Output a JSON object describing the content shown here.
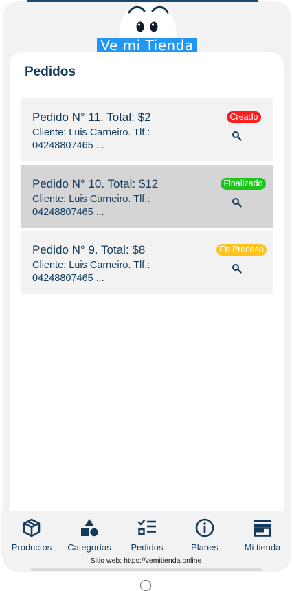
{
  "brand": {
    "name": "Ve mi Tienda"
  },
  "page": {
    "title": "Pedidos"
  },
  "orders": [
    {
      "title": "Pedido N° 11. Total: $2",
      "line1": "Cliente: Luis Carneiro. Tlf.:",
      "line2": "04248807465 ...",
      "status": "Creado",
      "status_color": "#ff1e1e"
    },
    {
      "title": "Pedido N° 10. Total: $12",
      "line1": "Cliente: Luis Carneiro. Tlf.:",
      "line2": "04248807465 ...",
      "status": "Finalizado",
      "status_color": "#1cc41c"
    },
    {
      "title": "Pedido N° 9. Total: $8",
      "line1": "Cliente: Luis Carneiro. Tlf.:",
      "line2": "04248807465 ...",
      "status": "En Proceso",
      "status_color": "#ffc41c"
    }
  ],
  "nav": {
    "items": [
      {
        "label": "Productos",
        "icon": "box-icon"
      },
      {
        "label": "Categorías",
        "icon": "shapes-icon"
      },
      {
        "label": "Pedidos",
        "icon": "checklist-icon"
      },
      {
        "label": "Planes",
        "icon": "info-icon"
      },
      {
        "label": "Mi tienda",
        "icon": "store-icon"
      }
    ]
  },
  "footer": {
    "site_label": "Sitio web:",
    "site_url": "https://vemitienda.online"
  },
  "colors": {
    "primary_text": "#113a5c",
    "brand_blue": "#2196f3",
    "background": "#f2f2f2"
  }
}
